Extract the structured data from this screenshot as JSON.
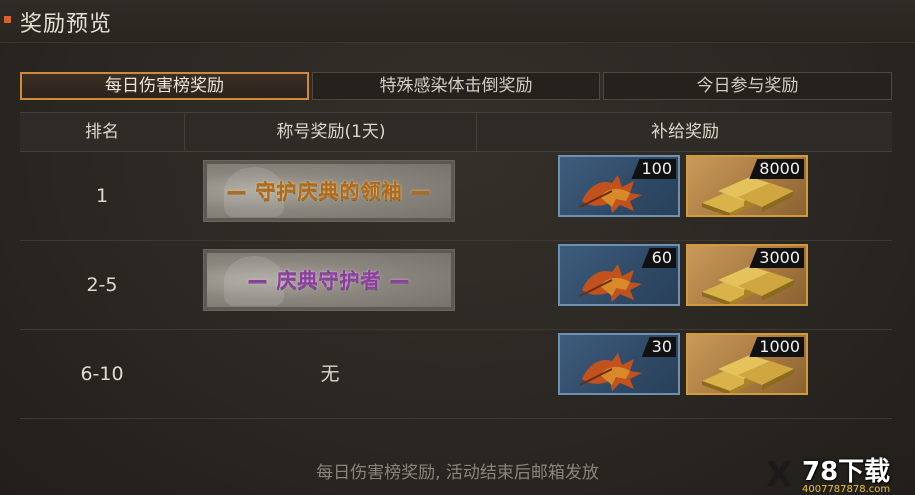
{
  "header": {
    "title": "奖励预览"
  },
  "tabs": [
    {
      "label": "每日伤害榜奖励",
      "active": true
    },
    {
      "label": "特殊感染体击倒奖励",
      "active": false
    },
    {
      "label": "今日参与奖励",
      "active": false
    }
  ],
  "table": {
    "columns": [
      "排名",
      "称号奖励(1天)",
      "补给奖励"
    ],
    "rows": [
      {
        "rank": "1",
        "title_badge": {
          "text": "— 守护庆典的领袖 —",
          "style": "gold"
        },
        "rewards": [
          {
            "icon": "maple-leaf-icon",
            "count": "100"
          },
          {
            "icon": "gold-bars-icon",
            "count": "8000"
          }
        ]
      },
      {
        "rank": "2-5",
        "title_badge": {
          "text": "— 庆典守护者 —",
          "style": "purple"
        },
        "rewards": [
          {
            "icon": "maple-leaf-icon",
            "count": "60"
          },
          {
            "icon": "gold-bars-icon",
            "count": "3000"
          }
        ]
      },
      {
        "rank": "6-10",
        "title_text": "无",
        "rewards": [
          {
            "icon": "maple-leaf-icon",
            "count": "30"
          },
          {
            "icon": "gold-bars-icon",
            "count": "1000"
          }
        ]
      }
    ]
  },
  "footer": {
    "note": "每日伤害榜奖励, 活动结束后邮箱发放"
  },
  "watermark": {
    "brand": "78下载",
    "url": "4007787878.com"
  },
  "colors": {
    "accent": "#d08a3b",
    "title_mark": "#d8622a",
    "leaf_frame": "#6e90b2",
    "gold_frame": "#d39a3a"
  }
}
